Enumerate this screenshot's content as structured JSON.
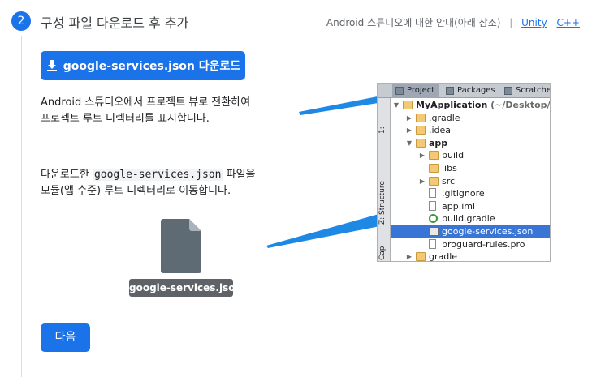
{
  "step": {
    "number": "2",
    "title": "구성 파일 다운로드 후 추가"
  },
  "links": {
    "guide": "Android 스튜디오에 대한 안내(아래 참조)",
    "separator": "|",
    "unity": "Unity",
    "cpp": "C++"
  },
  "download_button": {
    "label": "google-services.json 다운로드",
    "icon": "download-icon"
  },
  "instructions": {
    "line1": "Android 스튜디오에서 프로젝트 뷰로 전환하여",
    "line2": "프로젝트 루트 디렉터리를 표시합니다.",
    "line3_prefix": "다운로드한 ",
    "line3_code": "google-services.json",
    "line3_suffix": " 파일을",
    "line4": "모듈(앱 수준) 루트 디렉터리로 이동합니다."
  },
  "file_caption": "google-services.json",
  "next_button": "다음",
  "studio": {
    "tabs": [
      "Project",
      "Packages",
      "Scratches"
    ],
    "side_labels": [
      "1:",
      "Z: Structure",
      "Cap"
    ],
    "tree": [
      {
        "label": "MyApplication",
        "path": " (~/Desktop/My",
        "arrow": "▼",
        "depth": 0,
        "icon": "module-folder",
        "bold": true
      },
      {
        "label": ".gradle",
        "arrow": "▶",
        "depth": 1,
        "icon": "folder"
      },
      {
        "label": ".idea",
        "arrow": "▶",
        "depth": 1,
        "icon": "folder"
      },
      {
        "label": "app",
        "arrow": "▼",
        "depth": 1,
        "icon": "module-folder",
        "bold": true
      },
      {
        "label": "build",
        "arrow": "▶",
        "depth": 2,
        "icon": "folder"
      },
      {
        "label": "libs",
        "arrow": "",
        "depth": 2,
        "icon": "folder"
      },
      {
        "label": "src",
        "arrow": "▶",
        "depth": 2,
        "icon": "folder"
      },
      {
        "label": ".gitignore",
        "arrow": "",
        "depth": 2,
        "icon": "file"
      },
      {
        "label": "app.iml",
        "arrow": "",
        "depth": 2,
        "icon": "file"
      },
      {
        "label": "build.gradle",
        "arrow": "",
        "depth": 2,
        "icon": "gradle"
      },
      {
        "label": "google-services.json",
        "arrow": "",
        "depth": 2,
        "icon": "json",
        "selected": true
      },
      {
        "label": "proguard-rules.pro",
        "arrow": "",
        "depth": 2,
        "icon": "file"
      },
      {
        "label": "gradle",
        "arrow": "▶",
        "depth": 1,
        "icon": "folder"
      }
    ]
  },
  "colors": {
    "accent": "#1a73e8",
    "selection": "#3875d7",
    "caption_bg": "#5f6368"
  }
}
